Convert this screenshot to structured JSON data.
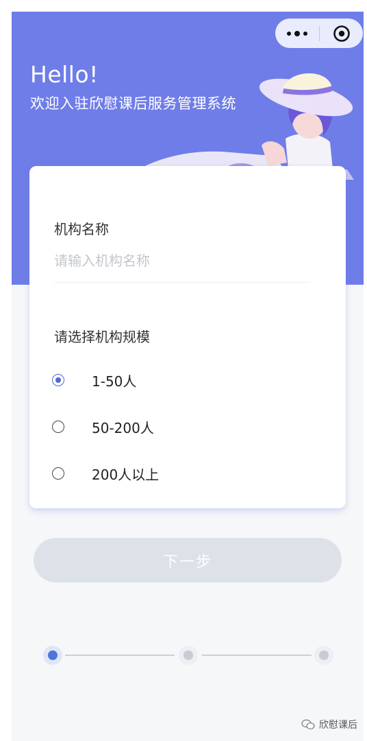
{
  "header": {
    "hello": "Hello!",
    "welcome": "欢迎入驻欣慰课后服务管理系统"
  },
  "form": {
    "name_label": "机构名称",
    "name_placeholder": "请输入机构名称",
    "name_value": "",
    "scale_label": "请选择机构规模",
    "options": [
      {
        "label": "1-50人",
        "selected": true
      },
      {
        "label": "50-200人",
        "selected": false
      },
      {
        "label": "200人以上",
        "selected": false
      }
    ]
  },
  "actions": {
    "next_label": "下一步",
    "next_enabled": false
  },
  "progress": {
    "total_steps": 3,
    "current_step": 1
  },
  "watermark": {
    "text": "欣慰课后"
  },
  "colors": {
    "hero": "#6f7de8",
    "accent": "#4f68d6",
    "button_disabled": "#dde2e8",
    "page_bg": "#f6f7f9"
  },
  "icons": {
    "more": "more-dots-icon",
    "close": "target-circle-icon",
    "radio_on": "radio-checked-icon",
    "radio_off": "radio-unchecked-icon",
    "watermark": "wechat-logo-icon"
  }
}
